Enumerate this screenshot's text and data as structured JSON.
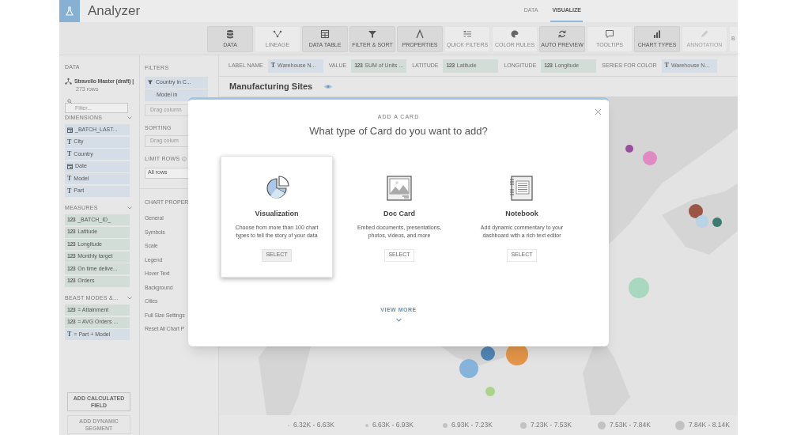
{
  "app": {
    "title": "Analyzer"
  },
  "tabs": [
    {
      "label": "DATA",
      "selected": false
    },
    {
      "label": "VISUALIZE",
      "selected": true
    }
  ],
  "toolbar": [
    {
      "label": "DATA",
      "active": true,
      "disabled": false
    },
    {
      "label": "LINEAGE",
      "active": false,
      "disabled": false
    },
    {
      "label": "DATA TABLE",
      "active": true,
      "disabled": false
    },
    {
      "label": "FILTER & SORT",
      "active": true,
      "disabled": false
    },
    {
      "label": "PROPERTIES",
      "active": true,
      "disabled": false
    },
    {
      "label": "QUICK FILTERS",
      "active": false,
      "disabled": false
    },
    {
      "label": "COLOR RULES",
      "active": false,
      "disabled": false
    },
    {
      "label": "AUTO PREVIEW",
      "active": true,
      "disabled": false
    },
    {
      "label": "TOOLTIPS",
      "active": false,
      "disabled": false
    },
    {
      "label": "CHART TYPES",
      "active": true,
      "disabled": false
    },
    {
      "label": "ANNOTATION",
      "active": false,
      "disabled": true
    },
    {
      "label": "B",
      "active": false,
      "disabled": false
    }
  ],
  "sidebar": {
    "heading": "DATA",
    "dataset": {
      "name": "Stravello Master (draft) |",
      "rows": "273 rows"
    },
    "filter_placeholder": "Filter...",
    "sections": [
      {
        "title": "DIMENSIONS",
        "items": [
          {
            "kind": "date",
            "label": "_BATCH_LAST..."
          },
          {
            "kind": "text",
            "badge": "T",
            "label": "City"
          },
          {
            "kind": "text",
            "badge": "T",
            "label": "Country"
          },
          {
            "kind": "date",
            "label": "Date"
          },
          {
            "kind": "text",
            "badge": "T",
            "label": "Model"
          },
          {
            "kind": "text",
            "badge": "T",
            "label": "Part"
          }
        ]
      },
      {
        "title": "MEASURES",
        "items": [
          {
            "kind": "number",
            "badge": "123",
            "label": "_BATCH_ID_"
          },
          {
            "kind": "number",
            "badge": "123",
            "label": "Latitude"
          },
          {
            "kind": "number",
            "badge": "123",
            "label": "Longitude"
          },
          {
            "kind": "number",
            "badge": "123",
            "label": "Monthly target"
          },
          {
            "kind": "number",
            "badge": "123",
            "label": "On time delive..."
          },
          {
            "kind": "number",
            "badge": "123",
            "label": "Orders"
          }
        ]
      },
      {
        "title": "BEAST MODES &...",
        "items": [
          {
            "kind": "number",
            "badge": "123",
            "label": "= Attainment"
          },
          {
            "kind": "number",
            "badge": "123",
            "label": "= AVG Orders ..."
          },
          {
            "kind": "text",
            "badge": "T",
            "label": "= Part + Model"
          }
        ]
      }
    ],
    "buttons": [
      {
        "label": "ADD CALCULATED FIELD",
        "disabled": false
      },
      {
        "label": "ADD DYNAMIC SEGMENT",
        "disabled": true
      }
    ]
  },
  "filters_panel": {
    "filters_heading": "FILTERS",
    "filters": [
      "Country in C...",
      "Model in"
    ],
    "filters_drop": "Drag column",
    "sorting_heading": "SORTING",
    "sorting_drop": "Drag colum",
    "limit_rows": {
      "label": "LIMIT ROWS",
      "value": "All rows"
    },
    "properties_heading": "CHART PROPER",
    "properties": [
      "General",
      "Symbols",
      "Scale",
      "Legend",
      "Hover Text",
      "Background",
      "Cities",
      "Full Size Settings",
      "Reset All Chart P"
    ]
  },
  "fields": [
    {
      "label": "LABEL NAME",
      "kind": "text",
      "badge": "T",
      "value": "Warehouse N..."
    },
    {
      "label": "VALUE",
      "kind": "number",
      "badge": "123",
      "value": "SUM of Units ..."
    },
    {
      "label": "LATITUDE",
      "kind": "number",
      "badge": "123",
      "value": "Latitude"
    },
    {
      "label": "LONGITUDE",
      "kind": "number",
      "badge": "123",
      "value": "Longitude"
    },
    {
      "label": "SERIES FOR COLOR",
      "kind": "text",
      "badge": "T",
      "value": "Warehouse N..."
    }
  ],
  "chart": {
    "title": "Manufacturing Sites",
    "legend": [
      "6.32K - 6.63K",
      "6.63K - 6.93K",
      "6.93K - 7.23K",
      "7.23K - 7.53K",
      "7.53K - 7.84K",
      "7.84K - 8.14K"
    ]
  },
  "modal": {
    "eyebrow": "ADD A CARD",
    "title": "What type of Card do you want to add?",
    "options": [
      {
        "title": "Visualization",
        "description": "Choose from more than 100 chart types to tell the story of your data",
        "button": "SELECT",
        "selected": true
      },
      {
        "title": "Doc Card",
        "description": "Embed documents, presentations, photos, videos, and more",
        "button": "SELECT",
        "selected": false
      },
      {
        "title": "Notebook",
        "description": "Add dynamic commentary to your dashboard with a rich text editor",
        "button": "SELECT",
        "selected": false
      }
    ],
    "view_more": "VIEW MORE"
  }
}
